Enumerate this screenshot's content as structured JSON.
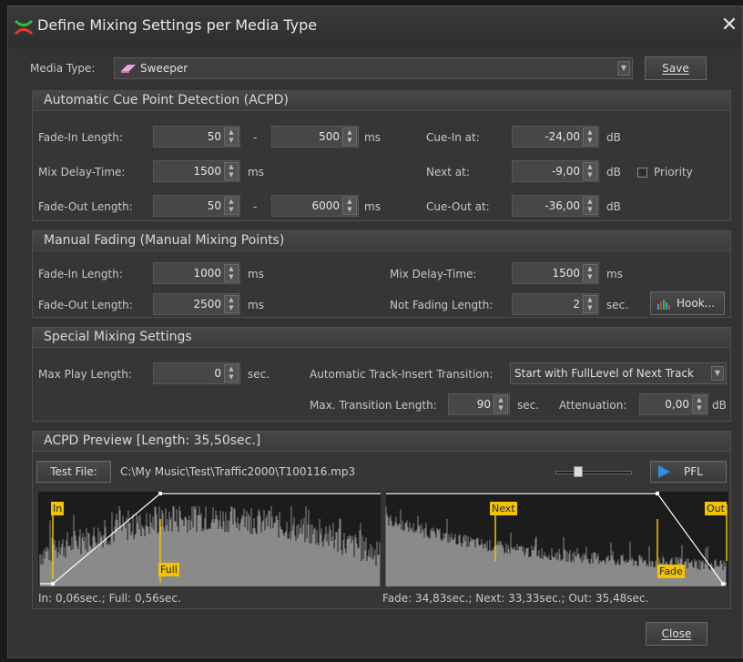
{
  "window": {
    "title": "Define Mixing Settings per Media Type",
    "close_glyph": "✕"
  },
  "media_type": {
    "label": "Media Type:",
    "value": "Sweeper",
    "icon": "eraser-icon",
    "save_label": "Save"
  },
  "acpd": {
    "title": "Automatic Cue Point Detection (ACPD)",
    "fade_in_label": "Fade-In Length:",
    "fade_in_min": "50",
    "fade_in_max": "500",
    "fade_in_dash": "-",
    "fade_in_unit": "ms",
    "mix_delay_label": "Mix Delay-Time:",
    "mix_delay": "1500",
    "mix_delay_unit": "ms",
    "fade_out_label": "Fade-Out Length:",
    "fade_out_min": "50",
    "fade_out_max": "6000",
    "fade_out_dash": "-",
    "fade_out_unit": "ms",
    "cue_in_label": "Cue-In at:",
    "cue_in": "-24,00",
    "cue_in_unit": "dB",
    "next_label": "Next at:",
    "next": "-9,00",
    "next_unit": "dB",
    "priority_label": "Priority",
    "priority_checked": false,
    "cue_out_label": "Cue-Out at:",
    "cue_out": "-36,00",
    "cue_out_unit": "dB"
  },
  "manual": {
    "title": "Manual Fading (Manual Mixing Points)",
    "fade_in_label": "Fade-In Length:",
    "fade_in": "1000",
    "fade_in_unit": "ms",
    "fade_out_label": "Fade-Out Length:",
    "fade_out": "2500",
    "fade_out_unit": "ms",
    "mix_delay_label": "Mix Delay-Time:",
    "mix_delay": "1500",
    "mix_delay_unit": "ms",
    "not_fading_label": "Not Fading Length:",
    "not_fading": "2",
    "not_fading_unit": "sec.",
    "hook_label": "Hook..."
  },
  "special": {
    "title": "Special Mixing Settings",
    "max_play_label": "Max Play Length:",
    "max_play": "0",
    "max_play_unit": "sec.",
    "transition_label": "Automatic Track-Insert Transition:",
    "transition_value": "Start with FullLevel of Next Track",
    "max_transition_label": "Max. Transition Length:",
    "max_transition": "90",
    "max_transition_unit": "sec.",
    "attenuation_label": "Attenuation:",
    "attenuation": "0,00",
    "attenuation_unit": "dB"
  },
  "preview": {
    "title": "ACPD Preview [Length: 35,50sec.]",
    "test_file_label": "Test File:",
    "file_path": "C:\\My Music\\Test\\Traffic2000\\T100116.mp3",
    "pfl_label": "PFL",
    "markers": {
      "in": "In",
      "full": "Full",
      "next": "Next",
      "out": "Out",
      "fade": "Fade"
    },
    "left_info": "In: 0,06sec.; Full: 0,56sec.",
    "right_info": "Fade: 34,83sec.; Next: 33,33sec.; Out: 35,48sec.",
    "colors": {
      "marker": "#f0c400",
      "wave": "#8a8a8a",
      "envelope": "#ffffff"
    }
  },
  "footer": {
    "close_label": "Close"
  }
}
